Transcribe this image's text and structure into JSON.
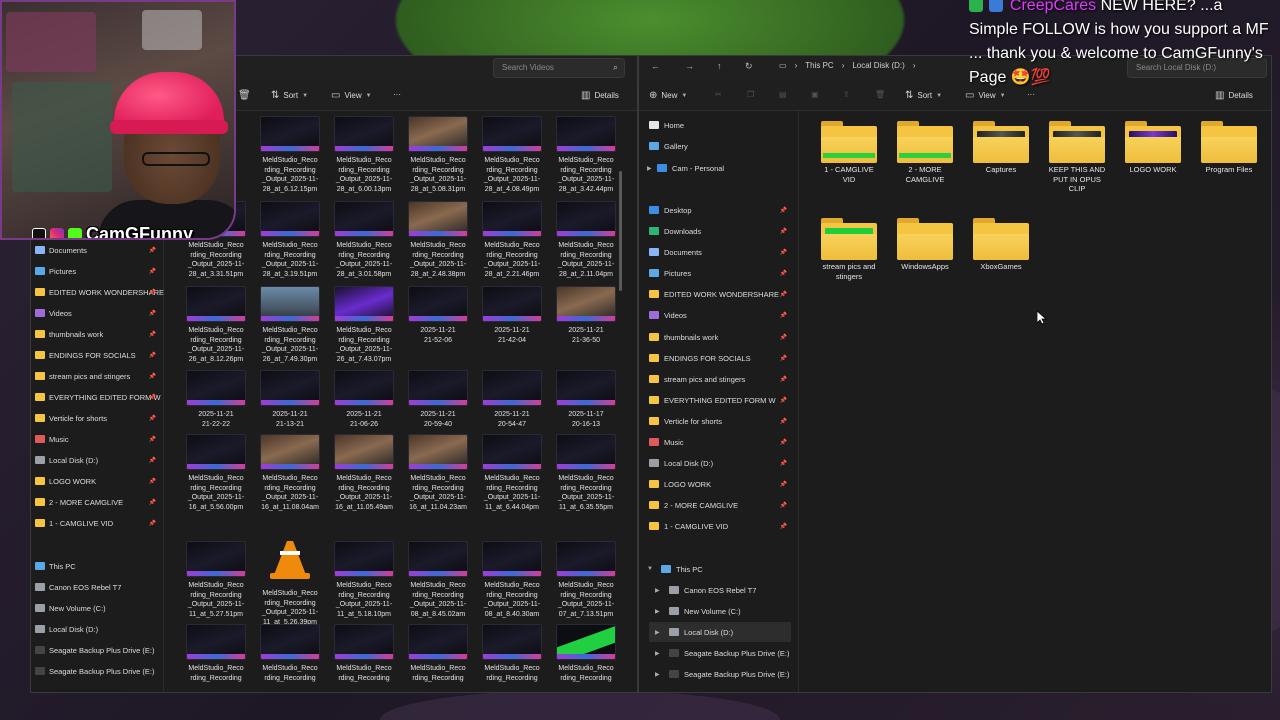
{
  "overlay": {
    "username": "CreepCares",
    "line1": "NEW HERE? ...a",
    "line2": "Simple FOLLOW is how you support a MF",
    "line3": "... thank you & welcome to CamGFunny's",
    "line4": "Page 🤩💯"
  },
  "cam": {
    "name": "CamGFunny"
  },
  "left_window": {
    "search_placeholder": "Search Videos",
    "toolbar": {
      "sort": "Sort",
      "view": "View",
      "more": "···",
      "details": "Details"
    },
    "nav": [
      {
        "label": "Documents",
        "color": "#8ab4f8",
        "pin": true
      },
      {
        "label": "Pictures",
        "color": "#5aa9e6",
        "pin": true
      },
      {
        "label": "EDITED WORK WONDERSHARE",
        "color": "#f5c542",
        "pin": true
      },
      {
        "label": "Videos",
        "color": "#a06ad8",
        "pin": true
      },
      {
        "label": "thumbnails work",
        "color": "#f5c542",
        "pin": true
      },
      {
        "label": "ENDINGS FOR SOCIALS",
        "color": "#f5c542",
        "pin": true
      },
      {
        "label": "stream pics and stingers",
        "color": "#f5c542",
        "pin": true
      },
      {
        "label": "EVERYTHING EDITED FORM W",
        "color": "#f5c542",
        "pin": true
      },
      {
        "label": "Verticle for shorts",
        "color": "#f5c542",
        "pin": true
      },
      {
        "label": "Music",
        "color": "#e05a5a",
        "pin": true
      },
      {
        "label": "Local Disk (D:)",
        "color": "#9aa0a6",
        "pin": true
      },
      {
        "label": "LOGO WORK",
        "color": "#f5c542",
        "pin": true
      },
      {
        "label": "2 - MORE CAMGLIVE",
        "color": "#f5c542",
        "pin": true
      },
      {
        "label": "1 - CAMGLIVE VID",
        "color": "#f5c542",
        "pin": true
      },
      {
        "label": "This PC",
        "color": "#5aa9e6",
        "pin": false
      },
      {
        "label": "Canon EOS Rebel T7",
        "color": "#9aa0a6",
        "pin": false
      },
      {
        "label": "New Volume (C:)",
        "color": "#9aa0a6",
        "pin": false
      },
      {
        "label": "Local Disk (D:)",
        "color": "#9aa0a6",
        "pin": false
      },
      {
        "label": "Seagate Backup Plus Drive (E:)",
        "color": "#444",
        "pin": false
      },
      {
        "label": "Seagate Backup Plus Drive (E:)",
        "color": "#444",
        "pin": false
      }
    ],
    "files": [
      {
        "cap": "MeldStudio_Reco\nrding_Recording\n_Output_2025-11-\n28_at_6.12.15pm",
        "kind": "dark"
      },
      {
        "cap": "MeldStudio_Reco\nrding_Recording\n_Output_2025-11-\n28_at_6.00.13pm",
        "kind": "dark"
      },
      {
        "cap": "MeldStudio_Reco\nrding_Recording\n_Output_2025-11-\n28_at_5.08.31pm",
        "kind": "face"
      },
      {
        "cap": "MeldStudio_Reco\nrding_Recording\n_Output_2025-11-\n28_at_4.08.49pm",
        "kind": "dark"
      },
      {
        "cap": "MeldStudio_Reco\nrding_Recording\n_Output_2025-11-\n28_at_3.42.44pm",
        "kind": "dark"
      },
      {
        "cap": "MeldStudio_Reco\nrding_Recording\n_Output_2025-11-\n28_at_3.31.51pm",
        "kind": "dark"
      },
      {
        "cap": "MeldStudio_Reco\nrding_Recording\n_Output_2025-11-\n28_at_3.19.51pm",
        "kind": "dark"
      },
      {
        "cap": "MeldStudio_Reco\nrding_Recording\n_Output_2025-11-\n28_at_3.01.58pm",
        "kind": "dark"
      },
      {
        "cap": "MeldStudio_Reco\nrding_Recording\n_Output_2025-11-\n28_at_2.48.38pm",
        "kind": "face"
      },
      {
        "cap": "MeldStudio_Reco\nrding_Recording\n_Output_2025-11-\n28_at_2.21.46pm",
        "kind": "dark"
      },
      {
        "cap": "MeldStudio_Reco\nrding_Recording\n_Output_2025-11-\n28_at_2.11.04pm",
        "kind": "dark"
      },
      {
        "cap": "MeldStudio_Reco\nrding_Recording\n_Output_2025-11-\n26_at_8.12.26pm",
        "kind": "dark"
      },
      {
        "cap": "MeldStudio_Reco\nrding_Recording\n_Output_2025-11-\n26_at_7.49.30pm",
        "kind": "city"
      },
      {
        "cap": "MeldStudio_Reco\nrding_Recording\n_Output_2025-11-\n26_at_7.43.07pm",
        "kind": "purple"
      },
      {
        "cap": "2025-11-21\n21-52-06",
        "kind": "dark"
      },
      {
        "cap": "2025-11-21\n21-42-04",
        "kind": "dark"
      },
      {
        "cap": "2025-11-21\n21-36-50",
        "kind": "face"
      },
      {
        "cap": "2025-11-21\n21-22-22",
        "kind": "dark"
      },
      {
        "cap": "2025-11-21\n21-13-21",
        "kind": "dark"
      },
      {
        "cap": "2025-11-21\n21-06-26",
        "kind": "dark"
      },
      {
        "cap": "2025-11-21\n20-59-40",
        "kind": "dark"
      },
      {
        "cap": "2025-11-21\n20-54-47",
        "kind": "dark"
      },
      {
        "cap": "2025-11-17\n20-16-13",
        "kind": "dark"
      },
      {
        "cap": "MeldStudio_Reco\nrding_Recording\n_Output_2025-11-\n16_at_5.56.00pm",
        "kind": "dark"
      },
      {
        "cap": "MeldStudio_Reco\nrding_Recording\n_Output_2025-11-\n16_at_11.08.04am",
        "kind": "face"
      },
      {
        "cap": "MeldStudio_Reco\nrding_Recording\n_Output_2025-11-\n16_at_11.05.49am",
        "kind": "face"
      },
      {
        "cap": "MeldStudio_Reco\nrding_Recording\n_Output_2025-11-\n16_at_11.04.23am",
        "kind": "face"
      },
      {
        "cap": "MeldStudio_Reco\nrding_Recording\n_Output_2025-11-\n11_at_6.44.04pm",
        "kind": "dark"
      },
      {
        "cap": "MeldStudio_Reco\nrding_Recording\n_Output_2025-11-\n11_at_6.35.55pm",
        "kind": "dark"
      },
      {
        "cap": "MeldStudio_Reco\nrding_Recording\n_Output_2025-11-\n11_at_5.27.51pm",
        "kind": "dark"
      },
      {
        "cap": "MeldStudio_Reco\nrding_Recording\n_Output_2025-11-\n11_at_5.26.39pm",
        "kind": "vlc"
      },
      {
        "cap": "MeldStudio_Reco\nrding_Recording\n_Output_2025-11-\n11_at_5.18.10pm",
        "kind": "dark"
      },
      {
        "cap": "MeldStudio_Reco\nrding_Recording\n_Output_2025-11-\n08_at_8.45.02am",
        "kind": "dark"
      },
      {
        "cap": "MeldStudio_Reco\nrding_Recording\n_Output_2025-11-\n08_at_8.40.30am",
        "kind": "dark"
      },
      {
        "cap": "MeldStudio_Reco\nrding_Recording\n_Output_2025-11-\n07_at_7.13.51pm",
        "kind": "dark"
      },
      {
        "cap": "MeldStudio_Reco\nrding_Recording",
        "kind": "dark"
      },
      {
        "cap": "MeldStudio_Reco\nrding_Recording",
        "kind": "dark"
      },
      {
        "cap": "MeldStudio_Reco\nrding_Recording",
        "kind": "dark"
      },
      {
        "cap": "MeldStudio_Reco\nrding_Recording",
        "kind": "dark"
      },
      {
        "cap": "MeldStudio_Reco\nrding_Recording",
        "kind": "dark"
      },
      {
        "cap": "MeldStudio_Reco\nrding_Recording",
        "kind": "green"
      }
    ]
  },
  "right_window": {
    "breadcrumbs": [
      "This PC",
      "Local Disk (D:)"
    ],
    "search_placeholder": "Search Local Disk (D:)",
    "toolbar": {
      "new": "New",
      "sort": "Sort",
      "view": "View",
      "more": "···",
      "details": "Details"
    },
    "nav": [
      {
        "label": "Home",
        "color": "#e6e6e6",
        "pin": false,
        "exp": false
      },
      {
        "label": "Gallery",
        "color": "#5aa9e6",
        "pin": false,
        "exp": false
      },
      {
        "label": "Cam - Personal",
        "color": "#3a8ee6",
        "pin": false,
        "exp": true
      },
      {
        "label": "Desktop",
        "color": "#3a8ee6",
        "pin": true,
        "exp": false
      },
      {
        "label": "Downloads",
        "color": "#2bb673",
        "pin": true,
        "exp": false
      },
      {
        "label": "Documents",
        "color": "#8ab4f8",
        "pin": true,
        "exp": false
      },
      {
        "label": "Pictures",
        "color": "#5aa9e6",
        "pin": true,
        "exp": false
      },
      {
        "label": "EDITED WORK WONDERSHARE",
        "color": "#f5c542",
        "pin": true,
        "exp": false
      },
      {
        "label": "Videos",
        "color": "#a06ad8",
        "pin": true,
        "exp": false
      },
      {
        "label": "thumbnails work",
        "color": "#f5c542",
        "pin": true,
        "exp": false
      },
      {
        "label": "ENDINGS FOR SOCIALS",
        "color": "#f5c542",
        "pin": true,
        "exp": false
      },
      {
        "label": "stream pics and stingers",
        "color": "#f5c542",
        "pin": true,
        "exp": false
      },
      {
        "label": "EVERYTHING EDITED FORM W",
        "color": "#f5c542",
        "pin": true,
        "exp": false
      },
      {
        "label": "Verticle for shorts",
        "color": "#f5c542",
        "pin": true,
        "exp": false
      },
      {
        "label": "Music",
        "color": "#e05a5a",
        "pin": true,
        "exp": false
      },
      {
        "label": "Local Disk (D:)",
        "color": "#9aa0a6",
        "pin": true,
        "exp": false
      },
      {
        "label": "LOGO WORK",
        "color": "#f5c542",
        "pin": true,
        "exp": false
      },
      {
        "label": "2 - MORE CAMGLIVE",
        "color": "#f5c542",
        "pin": true,
        "exp": false
      },
      {
        "label": "1 - CAMGLIVE VID",
        "color": "#f5c542",
        "pin": true,
        "exp": false
      }
    ],
    "tree": [
      {
        "label": "This PC",
        "color": "#5aa9e6",
        "exp": "open"
      },
      {
        "label": "Canon EOS Rebel T7",
        "color": "#9aa0a6",
        "exp": "closed"
      },
      {
        "label": "New Volume (C:)",
        "color": "#9aa0a6",
        "exp": "closed"
      },
      {
        "label": "Local Disk (D:)",
        "color": "#9aa0a6",
        "exp": "closed",
        "sel": true
      },
      {
        "label": "Seagate Backup Plus Drive (E:)",
        "color": "#444",
        "exp": "closed"
      },
      {
        "label": "Seagate Backup Plus Drive (E:)",
        "color": "#444",
        "exp": "closed"
      }
    ],
    "folders": [
      {
        "label": "1 - CAMGLIVE\nVID",
        "thumb": "green-stripe"
      },
      {
        "label": "2 - MORE\nCAMGLIVE",
        "thumb": "green-stripe"
      },
      {
        "label": "Captures",
        "thumb": "dark"
      },
      {
        "label": "KEEP THIS AND\nPUT IN OPUS\nCLIP",
        "thumb": "dark"
      },
      {
        "label": "LOGO WORK",
        "thumb": "purple"
      },
      {
        "label": "Program Files",
        "thumb": "none"
      },
      {
        "label": "stream pics and\nstingers",
        "thumb": "green"
      },
      {
        "label": "WindowsApps",
        "thumb": "none"
      },
      {
        "label": "XboxGames",
        "thumb": "none"
      }
    ]
  },
  "colors": {
    "folder": "#f5c542",
    "accent_purple": "#e03aff",
    "hat": "#e01e5a"
  }
}
